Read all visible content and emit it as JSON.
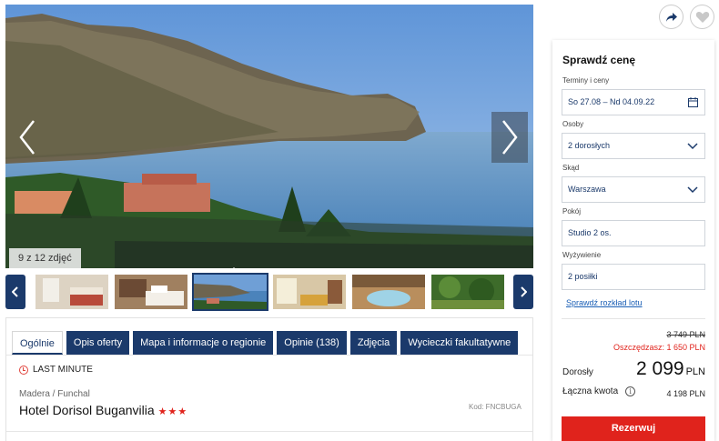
{
  "gallery": {
    "counter": "9 z 12 zdjęć",
    "thumbnails": [
      "room-1",
      "room-2",
      "sea-view",
      "living-room",
      "jacuzzi",
      "garden"
    ]
  },
  "tabs": [
    {
      "label": "Ogólnie",
      "active": true
    },
    {
      "label": "Opis oferty"
    },
    {
      "label": "Mapa i informacje o regionie"
    },
    {
      "label": "Opinie (138)"
    },
    {
      "label": "Zdjęcia"
    },
    {
      "label": "Wycieczki fakultatywne"
    }
  ],
  "hotel": {
    "badge": "LAST MINUTE",
    "location": "Madera / Funchal",
    "name": "Hotel Dorisol Buganvilia",
    "stars": "★★★",
    "code": "Kod: FNCBUGA"
  },
  "sidebar": {
    "title": "Sprawdź cenę",
    "terms_label": "Terminy i ceny",
    "terms_value": "So 27.08 – Nd 04.09.22",
    "persons_label": "Osoby",
    "persons_value": "2 dorosłych",
    "from_label": "Skąd",
    "from_value": "Warszawa",
    "room_label": "Pokój",
    "room_value": "Studio 2 os.",
    "board_label": "Wyżywienie",
    "board_value": "2 posiłki",
    "flight_link": "Sprawdź rozkład lotu",
    "old_price": "3 749 PLN",
    "save": "Oszczędzasz: 1 650 PLN",
    "adults_label": "Dorosły",
    "price": "2 099",
    "currency": "PLN",
    "total_label": "Łączna kwota",
    "total_value": "4 198 PLN",
    "reserve": "Rezerwuj"
  },
  "colors": {
    "navy": "#1b3a6b",
    "red": "#e0231c",
    "link": "#1b5fb5"
  }
}
